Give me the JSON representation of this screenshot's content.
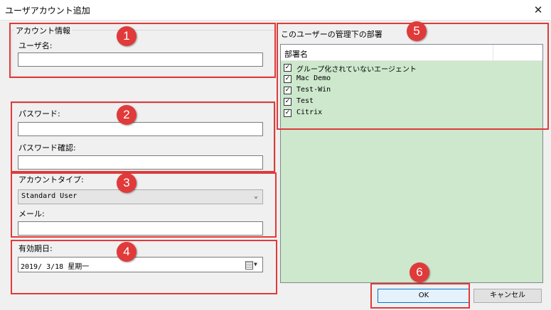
{
  "window": {
    "title": "ユーザアカウント追加",
    "close_glyph": "✕"
  },
  "account_info": {
    "legend": "アカウント情報",
    "username_label": "ユーザ名:",
    "username_value": ""
  },
  "password": {
    "password_label": "パスワード:",
    "password_value": "",
    "confirm_label": "パスワード確認:",
    "confirm_value": ""
  },
  "account_type": {
    "label": "アカウントタイプ:",
    "selected": "Standard User",
    "email_label": "メール:",
    "email_value": ""
  },
  "expiry": {
    "label": "有効期日:",
    "value": "2019/ 3/18 星期一"
  },
  "departments": {
    "title": "このユーザーの管理下の部署",
    "column_header": "部署名",
    "items": [
      {
        "label": "グループ化されていないエージェント",
        "checked": true
      },
      {
        "label": "Mac Demo",
        "checked": true
      },
      {
        "label": "Test-Win",
        "checked": true
      },
      {
        "label": "Test",
        "checked": true
      },
      {
        "label": "Citrix",
        "checked": true
      }
    ]
  },
  "buttons": {
    "ok": "OK",
    "cancel": "キャンセル"
  },
  "annotations": [
    "1",
    "2",
    "3",
    "4",
    "5",
    "6"
  ],
  "colors": {
    "annotation_red": "#e03a3a",
    "list_background": "#cde8cd",
    "ok_border": "#0078d7"
  },
  "icons": {
    "calendar": "calendar-icon",
    "dropdown": "chevron-down-icon",
    "check": "checkbox-checked-icon"
  }
}
